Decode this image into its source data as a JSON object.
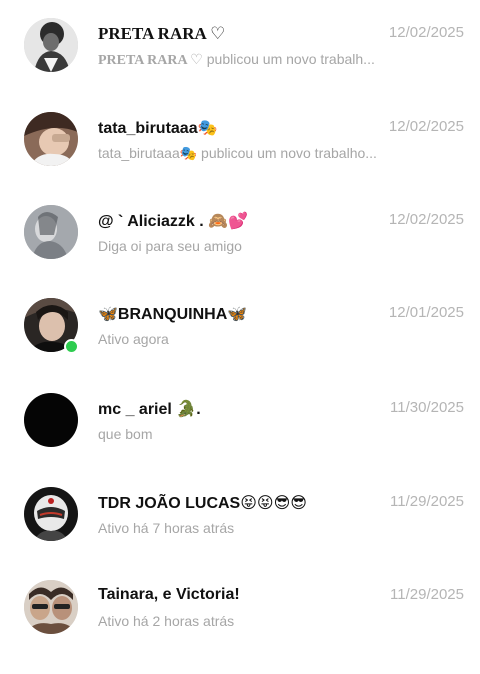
{
  "conversations": [
    {
      "name": "PRETA RARA ♡",
      "sub_author": "PRETA RARA ♡",
      "sub": "publicou um novo trabalh...",
      "date": "12/02/2025",
      "avatar": "avatar-bw-portrait",
      "online": false
    },
    {
      "name": "tata_birutaaa🎭",
      "sub": "tata_birutaaa🎭 publicou um novo trabalho...",
      "date": "12/02/2025",
      "avatar": "avatar-girl-photo",
      "online": false
    },
    {
      "name": "@ ` Aliciazzk . 🙈💕",
      "sub": "Diga oi para seu amigo",
      "date": "12/02/2025",
      "avatar": "avatar-girl-gray",
      "online": false
    },
    {
      "name": "🦋BRANQUINHA🦋",
      "sub": "Ativo agora",
      "date": "12/01/2025",
      "avatar": "avatar-selfie",
      "online": true
    },
    {
      "name": "mc _ ariel  🐊.",
      "sub": "que bom",
      "date": "11/30/2025",
      "avatar": "avatar-black",
      "online": false
    },
    {
      "name": "TDR JOÃO LUCAS😝😝😎😎",
      "sub": "Ativo há 7 horas atrás",
      "date": "11/29/2025",
      "avatar": "avatar-helmet",
      "online": false
    },
    {
      "name": "Tainara, e Victoria!",
      "sub": "Ativo há 2 horas atrás",
      "date": "11/29/2025",
      "avatar": "avatar-two-girls",
      "online": false
    }
  ]
}
